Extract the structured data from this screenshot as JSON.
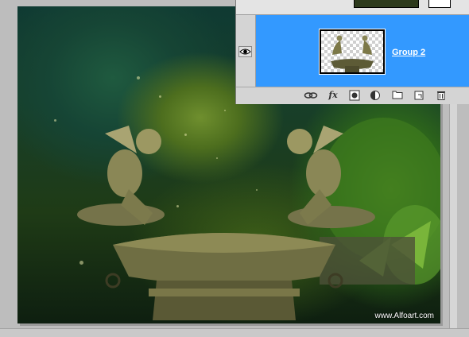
{
  "layers_panel": {
    "active_layer": {
      "name": "Group 2",
      "visible": true
    },
    "toolbar": {
      "link": "link-layers-icon",
      "fx": "fx",
      "mask": "layer-mask-icon",
      "adjustment": "adjustment-layer-icon",
      "group": "new-group-icon",
      "new_layer": "new-layer-icon",
      "delete": "trash-icon"
    }
  },
  "canvas": {
    "watermark": "www.Alfoart.com"
  },
  "colors": {
    "selection": "#3399ff",
    "panel": "#d4d4d4"
  }
}
